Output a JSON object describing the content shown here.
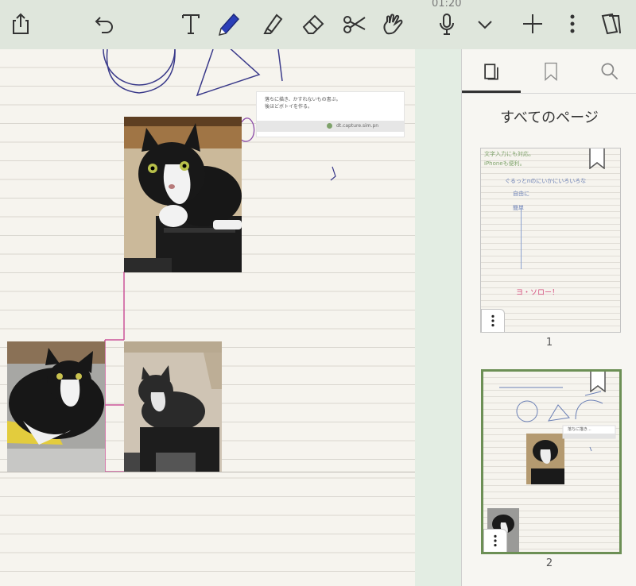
{
  "status": {
    "clock": "01:20"
  },
  "toolbar": {
    "share": "share-icon",
    "undo": "undo-icon",
    "text_tool": "text-tool-icon",
    "pen_tool": "pen-tool-icon",
    "highlighter_tool": "highlighter-tool-icon",
    "eraser_tool": "eraser-tool-icon",
    "scissors_tool": "scissors-tool-icon",
    "hand_tool": "hand-tool-icon",
    "mic": "microphone-icon",
    "mic_menu": "chevron-down-icon",
    "add": "plus-icon",
    "more": "more-vertical-icon",
    "pages": "pages-icon",
    "active_tool_color": "#2b3fb8"
  },
  "canvas": {
    "snippet": {
      "line1": "落ちに描き、かすれないもの書ぶ。",
      "line2": "後ほどボトイを作る。",
      "bar_label": "dt.capture.sim.pn"
    },
    "drawing_colors": {
      "ink": "#3a3a8a",
      "connector": "#cc5599"
    }
  },
  "panel": {
    "tabs": [
      "pages-tab",
      "bookmarks-tab",
      "search-tab"
    ],
    "title": "すべてのページ",
    "pages": [
      {
        "number": "1",
        "line1": "文字入力にも対応。",
        "line2": "iPhoneも便利。",
        "note": "ぐるっとnのにいかにいろいろな",
        "label_a": "自由に",
        "label_b": "簡単",
        "bottom": "ヨ・ソロー！"
      },
      {
        "number": "2",
        "snippet": "落ちに描き..."
      }
    ],
    "accent": "#6c8f55"
  }
}
